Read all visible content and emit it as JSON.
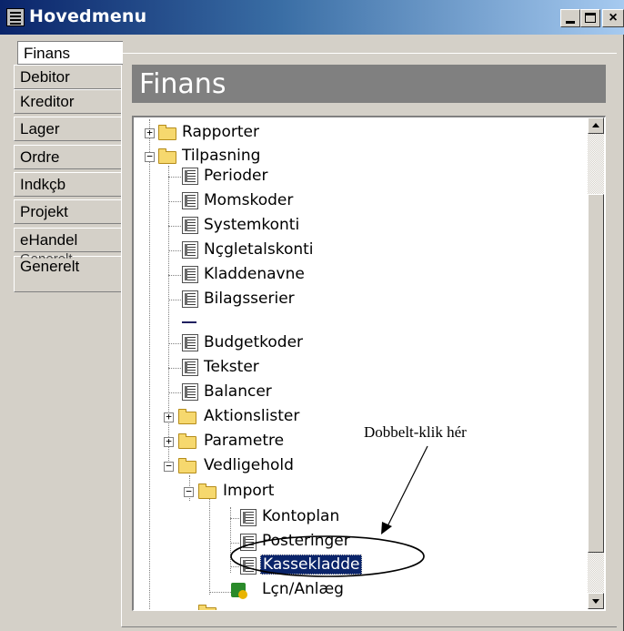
{
  "window": {
    "title": "Hovedmenu",
    "controls": {
      "minimize": "_",
      "maximize": "",
      "close": "×"
    }
  },
  "tabs": [
    {
      "label": "Finans",
      "active": true
    },
    {
      "label": "Debitor"
    },
    {
      "label": "Kreditor"
    },
    {
      "label": "Lager"
    },
    {
      "label": "Ordre"
    },
    {
      "label": "Indkçb"
    },
    {
      "label": "Projekt"
    },
    {
      "label": "eHandel"
    },
    {
      "label": "Generelt"
    }
  ],
  "panel": {
    "title": "Finans"
  },
  "tree": {
    "items": [
      {
        "label": "Rapporter",
        "icon": "folder-icon",
        "expander": "+"
      },
      {
        "label": "Tilpasning",
        "icon": "folder-icon",
        "expander": "−"
      },
      {
        "label": "Perioder",
        "icon": "report-icon"
      },
      {
        "label": "Momskoder",
        "icon": "report-icon"
      },
      {
        "label": "Systemkonti",
        "icon": "report-icon"
      },
      {
        "label": "Nçgletalskonti",
        "icon": "report-icon"
      },
      {
        "label": "Kladdenavne",
        "icon": "report-icon"
      },
      {
        "label": "Bilagsserier",
        "icon": "report-icon"
      },
      {
        "label": "Budgetkoder",
        "icon": "report-icon"
      },
      {
        "label": "Tekster",
        "icon": "report-icon"
      },
      {
        "label": "Balancer",
        "icon": "report-icon"
      },
      {
        "label": "Aktionslister",
        "icon": "folder-icon",
        "expander": "+"
      },
      {
        "label": "Parametre",
        "icon": "folder-icon",
        "expander": "+"
      },
      {
        "label": "Vedligehold",
        "icon": "folder-icon",
        "expander": "−"
      },
      {
        "label": "Import",
        "icon": "folder-icon",
        "expander": "−"
      },
      {
        "label": "Kontoplan",
        "icon": "report-icon"
      },
      {
        "label": "Posteringer",
        "icon": "report-icon"
      },
      {
        "label": "Kassekladde",
        "icon": "report-icon",
        "selected": true
      },
      {
        "label": "Lçn/Anlæg",
        "icon": "app-icon"
      }
    ]
  },
  "annotation": {
    "text": "Dobbelt-klik hér"
  }
}
